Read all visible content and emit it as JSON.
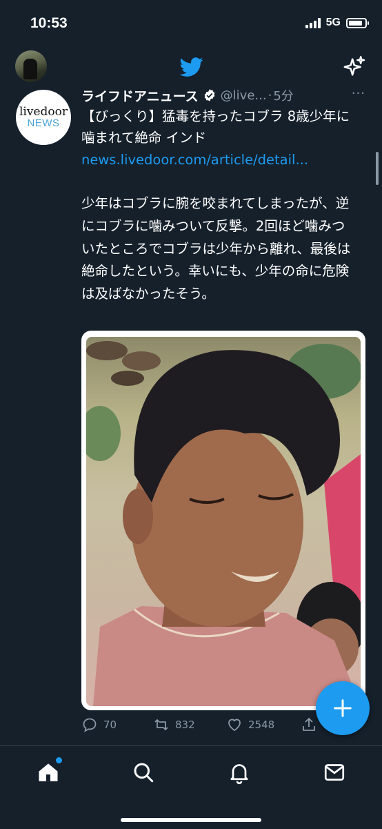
{
  "status_bar": {
    "time": "10:53",
    "network": "5G",
    "battery_level": 0.85
  },
  "header": {
    "logo_icon": "twitter-bird-icon",
    "sparkle_icon": "sparkle-icon"
  },
  "tweet": {
    "avatar": {
      "line1": "livedoor",
      "line2": "NEWS"
    },
    "display_name": "ライフドアニュース",
    "handle": "@live...",
    "dot": "·",
    "time": "5分",
    "more": "···",
    "headline": "【びっくり】猛毒を持ったコブラ 8歳少年に噛まれて絶命 インド",
    "link": "news.livedoor.com/article/detail...",
    "body": "少年はコブラに腕を咬まれてしまったが、逆にコブラに噛みついて反撃。2回ほど噛みついたところでコブラは少年から離れ、最後は絶命したという。幸いにも、少年の命に危険は及ばなかったそう。",
    "actions": {
      "replies": "70",
      "retweets": "832",
      "likes": "2548"
    }
  },
  "colors": {
    "background": "#15202b",
    "accent": "#1d9bf0",
    "muted": "#8b98a5"
  },
  "bottom_nav": [
    "home-icon",
    "search-icon",
    "notifications-icon",
    "messages-icon"
  ]
}
